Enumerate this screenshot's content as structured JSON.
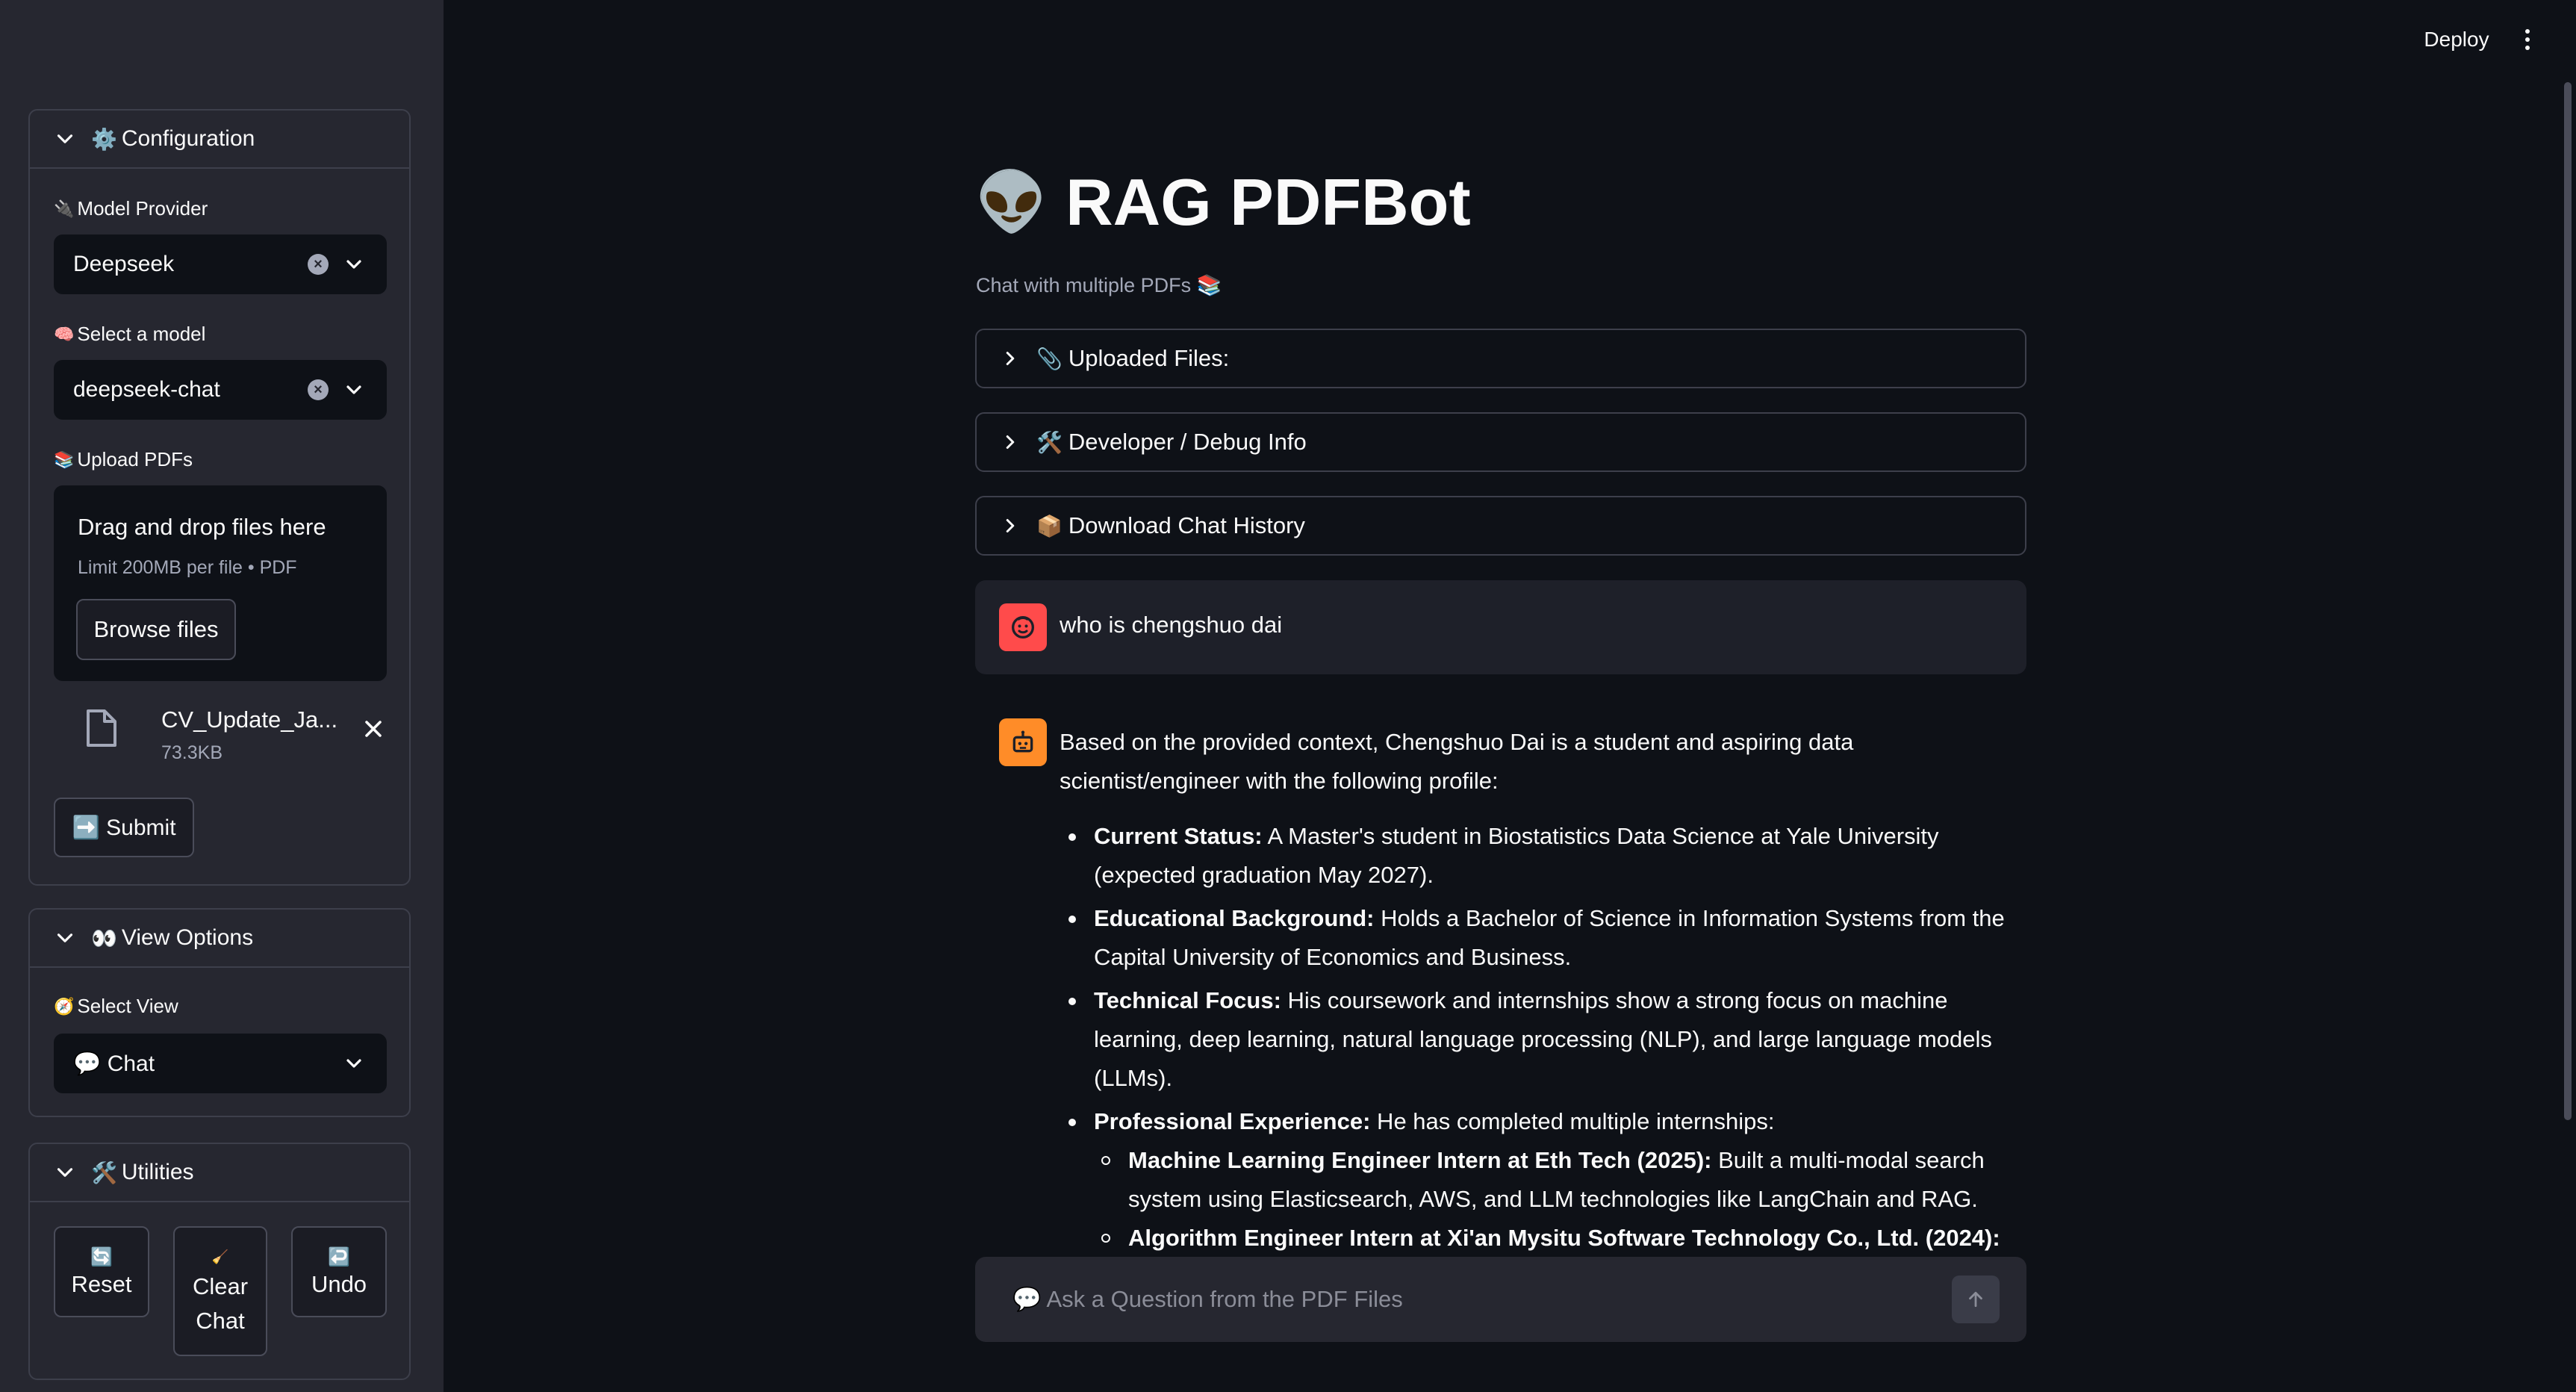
{
  "header": {
    "deploy_label": "Deploy"
  },
  "sidebar": {
    "config": {
      "title": "Configuration",
      "title_emoji": "⚙️",
      "model_provider_label": "Model Provider",
      "model_provider_emoji": "🔌",
      "model_provider_value": "Deepseek",
      "model_label": "Select a model",
      "model_emoji": "🧠",
      "model_value": "deepseek-chat",
      "upload_label": "Upload PDFs",
      "upload_emoji": "📚",
      "dropzone_title": "Drag and drop files here",
      "dropzone_limit": "Limit 200MB per file • PDF",
      "browse_label": "Browse files",
      "file_name": "CV_Update_Ja...",
      "file_size": "73.3KB",
      "submit_label": "➡️ Submit"
    },
    "view": {
      "title": "View Options",
      "title_emoji": "👀",
      "select_label": "Select View",
      "select_emoji": "🧭",
      "select_value": "💬 Chat"
    },
    "utilities": {
      "title": "Utilities",
      "title_emoji": "🛠️",
      "reset_emoji": "🔄",
      "reset_label": "Reset",
      "clear_emoji": "🧹",
      "clear_label_1": "Clear",
      "clear_label_2": "Chat",
      "undo_emoji": "↩️",
      "undo_label": "Undo"
    }
  },
  "main": {
    "title_emoji": "👽",
    "title": "RAG PDFBot",
    "subtitle": "Chat with multiple PDFs 📚",
    "expanders": [
      {
        "emoji": "📎",
        "label": "Uploaded Files:"
      },
      {
        "emoji": "🛠️",
        "label": "Developer / Debug Info"
      },
      {
        "emoji": "📦",
        "label": "Download Chat History"
      }
    ],
    "user_message": "who is chengshuo dai",
    "bot_intro": "Based on the provided context, Chengshuo Dai is a student and aspiring data scientist/engineer with the following profile:",
    "bullets": [
      {
        "bold": "Current Status:",
        "text": " A Master's student in Biostatistics Data Science at Yale University (expected graduation May 2027)."
      },
      {
        "bold": "Educational Background:",
        "text": " Holds a Bachelor of Science in Information Systems from the Capital University of Economics and Business."
      },
      {
        "bold": "Technical Focus:",
        "text": " His coursework and internships show a strong focus on machine learning, deep learning, natural language processing (NLP), and large language models (LLMs)."
      },
      {
        "bold": "Professional Experience:",
        "text": " He has completed multiple internships:"
      }
    ],
    "sub_bullets": [
      {
        "bold": "Machine Learning Engineer Intern at Eth Tech (2025):",
        "text": " Built a multi-modal search system using Elasticsearch, AWS, and LLM technologies like LangChain and RAG."
      },
      {
        "bold": "Algorithm Engineer Intern at Xi'an Mysitu Software Technology Co., Ltd. (2024):",
        "text": ""
      }
    ],
    "chat_placeholder": "💬 Ask a Question from the PDF Files"
  },
  "colors": {
    "background": "#0e1117",
    "sidebar": "#262730",
    "user_avatar": "#ff4b4b",
    "bot_avatar": "#ff8c28"
  }
}
